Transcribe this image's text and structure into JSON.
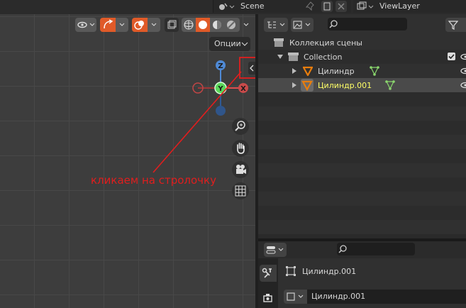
{
  "top_bar": {
    "scene_label": "Scene",
    "viewlayer_label": "ViewLayer"
  },
  "viewport": {
    "options_label": "Опции",
    "gizmo": {
      "z": "Z",
      "y": "Y",
      "x": "X"
    },
    "nav_icons": [
      "zoom-icon",
      "hand-pan-icon",
      "camera-icon",
      "grid-icon"
    ]
  },
  "annotation": {
    "text": "кликаем на стролочку",
    "color": "#e01e1e"
  },
  "outliner": {
    "scene_collection_label": "Коллекция сцены",
    "collection_label": "Collection",
    "items": [
      {
        "label": "Цилиндр",
        "selected": false
      },
      {
        "label": "Цилиндр.001",
        "selected": true
      }
    ]
  },
  "properties": {
    "object_name": "Цилиндр.001",
    "data_name": "Цилиндр.001"
  },
  "colors": {
    "accent_orange": "#e87d0d",
    "selected_text": "#ffff66",
    "mesh_green": "#8ad66d",
    "axis_x": "#e05050",
    "axis_y": "#6bd66b",
    "axis_z": "#4f8ad6"
  }
}
